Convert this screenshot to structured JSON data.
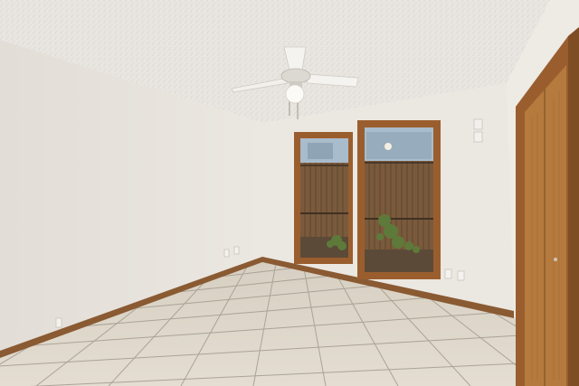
{
  "scene": {
    "subject": "empty room",
    "colors": {
      "ceiling": "#e9e6e1",
      "wall_left": "#e6e2dc",
      "wall_back": "#ebe7e1",
      "wall_right": "#ece8e2",
      "tile": "#dcd5c8",
      "grout": "#a9a294",
      "baseboard": "#8a5a32",
      "wood_trim": "#9a5e2e",
      "door": "#b57a3e",
      "fence": "#7a5a3c",
      "sky": "#9fb3c2",
      "plant": "#5e7a3a"
    },
    "icons": [
      "ceiling-fan-icon",
      "light-bulb-icon",
      "outlet-icon",
      "light-switch-icon"
    ]
  }
}
